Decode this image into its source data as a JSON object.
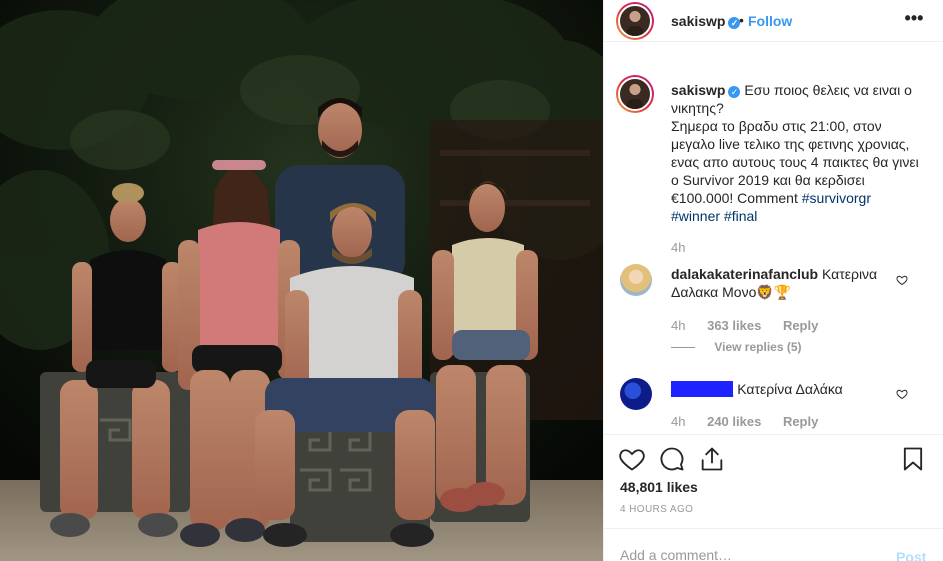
{
  "post": {
    "username": "sakiswp",
    "follow_label": "Follow",
    "separator": "•",
    "more_label": "•••",
    "verified_mark": "✓"
  },
  "caption": {
    "username": "sakiswp",
    "text_line1": "Εσυ ποιος θελεις να ειναι ο νικητης?",
    "text_line2": "Σημερα το βραδυ στις 21:00, στον μεγαλο live τελικο της φετινης χρονιας, ενας απο αυτους τους 4 παικτες θα γινει ο Survivor 2019 και θα κερδισει €100.000! Comment",
    "hashtags": [
      "#survivorgr",
      "#winner",
      "#final"
    ],
    "time": "4h"
  },
  "comments": [
    {
      "username": "dalakakaterinafanclub",
      "text": "Κατερινα Δαλακα Mονο🦁🏆",
      "time": "4h",
      "likes": "363 likes",
      "reply_label": "Reply",
      "view_replies": "View replies (5)"
    },
    {
      "username": "________",
      "text": "Κατερίνα Δαλάκα",
      "time": "4h",
      "likes": "240 likes",
      "reply_label": "Reply"
    }
  ],
  "actions": {
    "like_icon": "heart-icon",
    "comment_icon": "comment-icon",
    "share_icon": "share-icon",
    "save_icon": "bookmark-icon"
  },
  "likes_count": "48,801 likes",
  "time_ago": "4 HOURS AGO",
  "add_comment": {
    "placeholder": "Add a comment…",
    "post_label": "Post"
  },
  "colors": {
    "link_blue": "#3897f0",
    "hashtag": "#003569",
    "muted": "#999999",
    "post_disabled": "#b2dffc",
    "redaction": "#1e22ff"
  }
}
